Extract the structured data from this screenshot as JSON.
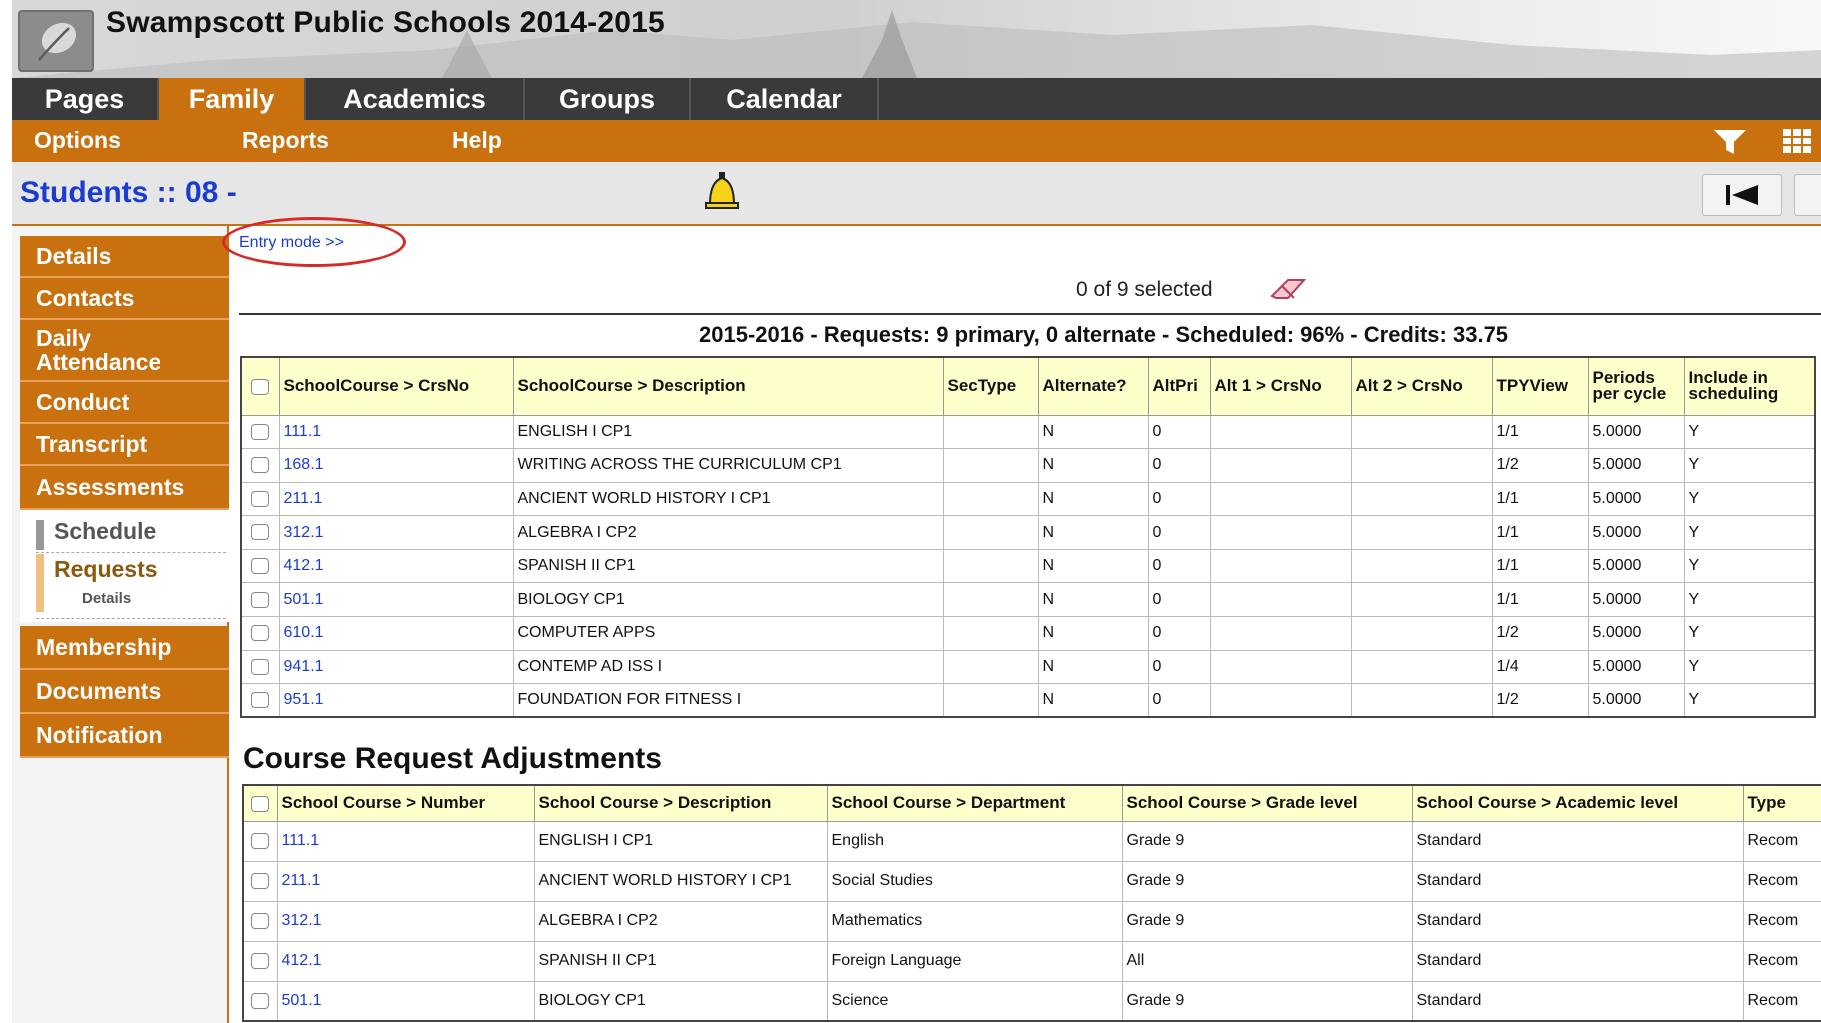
{
  "header": {
    "title": "Swampscott Public Schools 2014-2015"
  },
  "top_tabs": [
    {
      "label": "Pages"
    },
    {
      "label": "Family"
    },
    {
      "label": "Academics"
    },
    {
      "label": "Groups"
    },
    {
      "label": "Calendar"
    }
  ],
  "sub_menu": {
    "options": "Options",
    "reports": "Reports",
    "help": "Help"
  },
  "page": {
    "title": "Students :: 08 -",
    "entry_mode": "Entry mode >>",
    "selected": "0 of 9 selected",
    "summary": "2015-2016 - Requests: 9 primary, 0 alternate - Scheduled: 96% - Credits: 33.75"
  },
  "side_nav": {
    "items_top": [
      "Details",
      "Contacts",
      "Daily Attendance",
      "Conduct",
      "Transcript",
      "Assessments"
    ],
    "schedule": "Schedule",
    "requests": "Requests",
    "requests_details": "Details",
    "items_bottom": [
      "Membership",
      "Documents",
      "Notification"
    ]
  },
  "requests_table": {
    "headers": [
      "SchoolCourse > CrsNo",
      "SchoolCourse > Description",
      "SecType",
      "Alternate?",
      "AltPri",
      "Alt 1 > CrsNo",
      "Alt 2 > CrsNo",
      "TPYView",
      "Periods per cycle",
      "Include in scheduling"
    ],
    "rows": [
      [
        "111.1",
        "ENGLISH I CP1",
        "",
        "N",
        "0",
        "",
        "",
        "1/1",
        "5.0000",
        "Y"
      ],
      [
        "168.1",
        "WRITING ACROSS THE CURRICULUM CP1",
        "",
        "N",
        "0",
        "",
        "",
        "1/2",
        "5.0000",
        "Y"
      ],
      [
        "211.1",
        "ANCIENT WORLD HISTORY I CP1",
        "",
        "N",
        "0",
        "",
        "",
        "1/1",
        "5.0000",
        "Y"
      ],
      [
        "312.1",
        "ALGEBRA I CP2",
        "",
        "N",
        "0",
        "",
        "",
        "1/1",
        "5.0000",
        "Y"
      ],
      [
        "412.1",
        "SPANISH II CP1",
        "",
        "N",
        "0",
        "",
        "",
        "1/1",
        "5.0000",
        "Y"
      ],
      [
        "501.1",
        "BIOLOGY CP1",
        "",
        "N",
        "0",
        "",
        "",
        "1/1",
        "5.0000",
        "Y"
      ],
      [
        "610.1",
        "COMPUTER APPS",
        "",
        "N",
        "0",
        "",
        "",
        "1/2",
        "5.0000",
        "Y"
      ],
      [
        "941.1",
        "CONTEMP AD ISS I",
        "",
        "N",
        "0",
        "",
        "",
        "1/4",
        "5.0000",
        "Y"
      ],
      [
        "951.1",
        "FOUNDATION FOR FITNESS I",
        "",
        "N",
        "0",
        "",
        "",
        "1/2",
        "5.0000",
        "Y"
      ]
    ]
  },
  "adjustments": {
    "heading": "Course Request Adjustments",
    "headers": [
      "School Course > Number",
      "School Course > Description",
      "School Course > Department",
      "School Course > Grade level",
      "School Course > Academic level",
      "Type"
    ],
    "rows": [
      [
        "111.1",
        "ENGLISH I CP1",
        "English",
        "Grade 9",
        "Standard",
        "Recom"
      ],
      [
        "211.1",
        "ANCIENT WORLD HISTORY I CP1",
        "Social Studies",
        "Grade 9",
        "Standard",
        "Recom"
      ],
      [
        "312.1",
        "ALGEBRA I CP2",
        "Mathematics",
        "Grade 9",
        "Standard",
        "Recom"
      ],
      [
        "412.1",
        "SPANISH II CP1",
        "Foreign Language",
        "All",
        "Standard",
        "Recom"
      ],
      [
        "501.1",
        "BIOLOGY CP1",
        "Science",
        "Grade 9",
        "Standard",
        "Recom"
      ]
    ]
  },
  "icons": {
    "logo": "leaf-logo-icon",
    "filter": "filter-icon",
    "grid": "grid-icon",
    "bell": "bell-icon",
    "first": "first-page-icon",
    "eraser": "eraser-icon"
  },
  "colors": {
    "accent": "#c9700f",
    "tab_bar": "#3a3a3a",
    "link": "#1a3ccf",
    "header_cell": "#ffffcc",
    "highlight_circle": "#d62a2a"
  }
}
